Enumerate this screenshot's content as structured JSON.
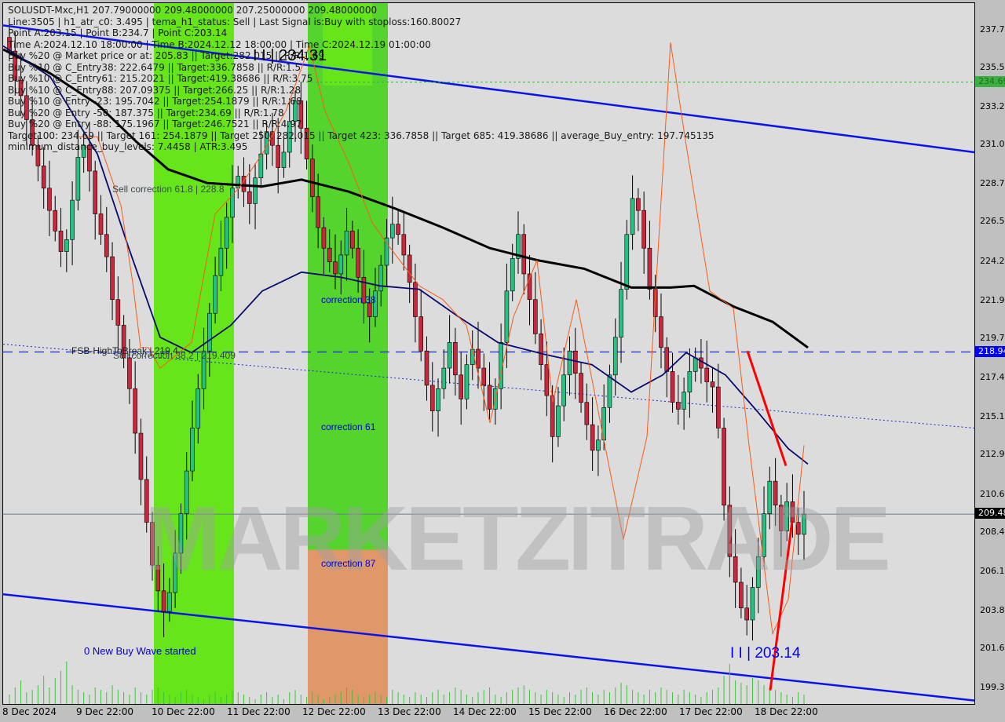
{
  "chart_data": {
    "type": "candlestick",
    "symbol": "SOLUSDT-Mxc",
    "timeframe": "H1",
    "title": "SOLUSDT-Mxc,H1  207.79000000 209.48000000 207.25000000 209.48000000",
    "ohlc_header": {
      "open": 207.79,
      "high": 209.48,
      "low": 207.25,
      "close": 209.48
    },
    "info_lines": [
      "SOLUSDT-Mxc,H1  207.79000000 209.48000000 207.25000000 209.48000000",
      "Line:3505 | h1_atr_c0: 3.495 | tema_h1_status: Sell | Last Signal is:Buy with stoploss:160.80027",
      "Point A:203.15 | Point B:234.7 | Point C:203.14",
      "Time A:2024.12.10 18:00:00 | Time B:2024.12.12 18:00:00 | Time C:2024.12.19 01:00:00",
      "Buy %20 @ Market price or at: 205.83 || Target:282.015 || R/R:1.69",
      "Buy %10 @ C_Entry38: 222.6479 || Target:336.7858 || R/R:1.5",
      "Buy %10 @ C_Entry61: 215.2021 || Target:419.38686 || R/R:3.75",
      "Buy %10 @ C_Entry88: 207.09375 || Target:266.25 || R/R:1.28",
      "Buy %10 @ Entry -23: 195.7042 || Target:254.1879 || R/R:1.68",
      "Buy %20 @ Entry -50: 187.375 || Target:234.69 || R/R:1.78",
      "Buy %20 @ Entry -88: 175.1967 || Target:246.7521 || R/R:4.97",
      "Target100: 234.69 || Target 161: 254.1879 || Target 250: 282.015 || Target 423: 336.7858 || Target 685: 419.38686 || average_Buy_entry: 197.745135",
      "minimum_distance_buy_levels: 7.4458 | ATR:3.495"
    ],
    "y_axis": {
      "ticks": [
        237.7,
        235.5,
        233.2,
        231.0,
        228.7,
        226.5,
        224.2,
        221.9,
        219.7,
        217.4,
        215.1,
        212.9,
        210.6,
        208.4,
        206.1,
        203.8,
        201.6,
        199.3
      ],
      "tick_labels": [
        "237.74",
        "235.51",
        "233.26",
        "231.02",
        "228.78",
        "226.53",
        "224.29",
        "221.99",
        "219.75",
        "217.43",
        "215.17",
        "212.92",
        "210.68",
        "208.44",
        "206.14",
        "203.89",
        "201.65",
        "199.39"
      ],
      "range": [
        198.4,
        239.3
      ]
    },
    "x_axis": {
      "tick_labels": [
        "8 Dec 2024",
        "9 Dec 22:00",
        "10 Dec 22:00",
        "11 Dec 22:00",
        "12 Dec 22:00",
        "13 Dec 22:00",
        "14 Dec 22:00",
        "15 Dec 22:00",
        "16 Dec 22:00",
        "17 Dec 22:00",
        "18 Dec 22:00"
      ]
    },
    "price_markers": [
      {
        "label": "234.69",
        "value": 234.69,
        "color": "#3cb043",
        "text_color": "#1a6e1a"
      },
      {
        "label": "218.94",
        "value": 218.94,
        "color": "#0000ff",
        "text_color": "#ffffff"
      },
      {
        "label": "209.48",
        "value": 209.48,
        "color": "#000000",
        "text_color": "#ffffff"
      }
    ],
    "annotations": {
      "point_b": "I I | 234.31",
      "point_c": "I I | 203.14",
      "sell_correction_618": "Sell correction 61.8 | 228.8",
      "sell_correction_382": "Sell correction 38.2 | 219.409",
      "fsb_high": "FSB-HighToBreak | 219.4",
      "correction_38": "correction 38",
      "correction_61": "correction 61",
      "correction_87": "correction 87",
      "new_wave": "0 New Buy Wave started",
      "watermark": "MARKETZITRADE"
    },
    "levels": {
      "target100": 234.69,
      "dashed_blue": 218.94,
      "current_price": 209.48
    },
    "channel": {
      "upper": {
        "start": 238.0,
        "end": 230.6
      },
      "lower": {
        "start": 204.8,
        "end": 198.6
      }
    },
    "zones": [
      {
        "name": "buy-zone-1",
        "from": "10 Dec 00:00",
        "to": "11 Dec 10:00",
        "color": "#66e61a"
      },
      {
        "name": "buy-zone-2",
        "from": "12 Dec 00:00",
        "to": "13 Dec 02:00",
        "color": "#55d42e"
      },
      {
        "name": "correction-87-zone",
        "from": "12 Dec 00:00",
        "to": "13 Dec 02:00",
        "color": "#e0986a"
      }
    ],
    "closes": [
      236.5,
      234.8,
      233.9,
      232.5,
      231.0,
      229.8,
      228.5,
      227.2,
      226.0,
      224.8,
      225.5,
      227.8,
      230.3,
      231.0,
      229.5,
      227.0,
      225.8,
      224.5,
      222.0,
      220.5,
      218.6,
      216.8,
      214.2,
      211.5,
      209.0,
      206.5,
      205.0,
      203.8,
      204.9,
      207.2,
      209.5,
      212.0,
      214.5,
      216.8,
      219.0,
      221.2,
      223.4,
      225.0,
      226.8,
      228.5,
      229.2,
      228.3,
      227.6,
      229.1,
      230.5,
      231.8,
      231.0,
      229.7,
      230.6,
      232.4,
      233.6,
      232.0,
      230.2,
      228.0,
      226.2,
      225.0,
      224.2,
      223.5,
      224.6,
      226.0,
      225.0,
      223.3,
      221.8,
      221.0,
      222.5,
      224.0,
      225.6,
      226.4,
      225.8,
      224.6,
      223.0,
      221.0,
      219.0,
      217.0,
      215.5,
      216.8,
      218.0,
      219.5,
      217.6,
      216.2,
      218.2,
      219.1,
      218.0,
      217.0,
      215.6,
      216.8,
      219.5,
      222.5,
      224.4,
      225.8,
      223.5,
      222.0,
      220.0,
      218.2,
      216.4,
      214.0,
      215.8,
      217.6,
      219.0,
      217.7,
      216.0,
      214.7,
      213.2,
      213.8,
      215.7,
      217.6,
      219.8,
      222.6,
      225.8,
      227.9,
      227.2,
      225.0,
      222.6,
      221.0,
      219.2,
      217.8,
      216.0,
      215.6,
      216.6,
      217.8,
      218.6,
      218.0,
      217.2,
      216.9,
      214.5,
      210.0,
      207.0,
      205.5,
      204.0,
      203.3,
      205.2,
      207.0,
      209.5,
      211.4,
      210.0,
      208.5,
      210.2,
      209.0,
      208.3,
      209.48
    ],
    "volume_relative": [
      0.2,
      0.35,
      0.5,
      0.25,
      0.3,
      0.4,
      0.6,
      0.35,
      0.55,
      0.7,
      0.9,
      0.4,
      0.3,
      0.25,
      0.2,
      0.35,
      0.3,
      0.25,
      0.4,
      0.3,
      0.25,
      0.2,
      0.35,
      0.25,
      0.2,
      0.3,
      0.35,
      0.25,
      0.2,
      0.15,
      0.25,
      0.3,
      0.2,
      0.15,
      0.1,
      0.2,
      0.25,
      0.15,
      0.2,
      0.3,
      0.25,
      0.2,
      0.15,
      0.1,
      0.2,
      0.25,
      0.15,
      0.2,
      0.1,
      0.25,
      0.3,
      0.2,
      0.15,
      0.25,
      0.2,
      0.1,
      0.15,
      0.2,
      0.25,
      0.35,
      0.3,
      0.2,
      0.15,
      0.2,
      0.25,
      0.2,
      0.15,
      0.3,
      0.25,
      0.2,
      0.15,
      0.25,
      0.2,
      0.15,
      0.25,
      0.3,
      0.2,
      0.25,
      0.35,
      0.3,
      0.2,
      0.15,
      0.25,
      0.3,
      0.35,
      0.2,
      0.15,
      0.25,
      0.3,
      0.35,
      0.4,
      0.3,
      0.25,
      0.2,
      0.3,
      0.25,
      0.2,
      0.15,
      0.25,
      0.2,
      0.3,
      0.35,
      0.25,
      0.2,
      0.3,
      0.25,
      0.35,
      0.45,
      0.4,
      0.3,
      0.25,
      0.2,
      0.3,
      0.25,
      0.35,
      0.3,
      0.25,
      0.2,
      0.3,
      0.25,
      0.2,
      0.15,
      0.25,
      0.3,
      0.35,
      0.6,
      0.85,
      0.5,
      0.45,
      0.4,
      0.55,
      0.5,
      0.4,
      0.35,
      0.3,
      0.25,
      0.2,
      0.15,
      0.25,
      0.2
    ]
  }
}
